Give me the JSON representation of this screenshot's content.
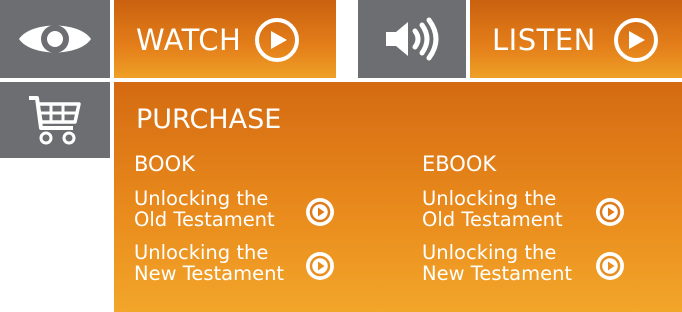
{
  "watch": {
    "label": "WATCH",
    "icon": "eye-icon"
  },
  "listen": {
    "label": "LISTEN",
    "icon": "speaker-icon"
  },
  "purchase": {
    "title": "PURCHASE",
    "icon": "cart-icon",
    "book": {
      "heading": "BOOK",
      "items": [
        {
          "line1": "Unlocking the",
          "line2": "Old Testament"
        },
        {
          "line1": "Unlocking the",
          "line2": "New Testament"
        }
      ]
    },
    "ebook": {
      "heading": "EBOOK",
      "items": [
        {
          "line1": "Unlocking the",
          "line2": "Old Testament"
        },
        {
          "line1": "Unlocking the",
          "line2": "New Testament"
        }
      ]
    }
  },
  "colors": {
    "tile_gray": "#6d6e71",
    "orange_dark": "#c9610f",
    "orange_light": "#f2a62a",
    "text": "#ffffff"
  }
}
